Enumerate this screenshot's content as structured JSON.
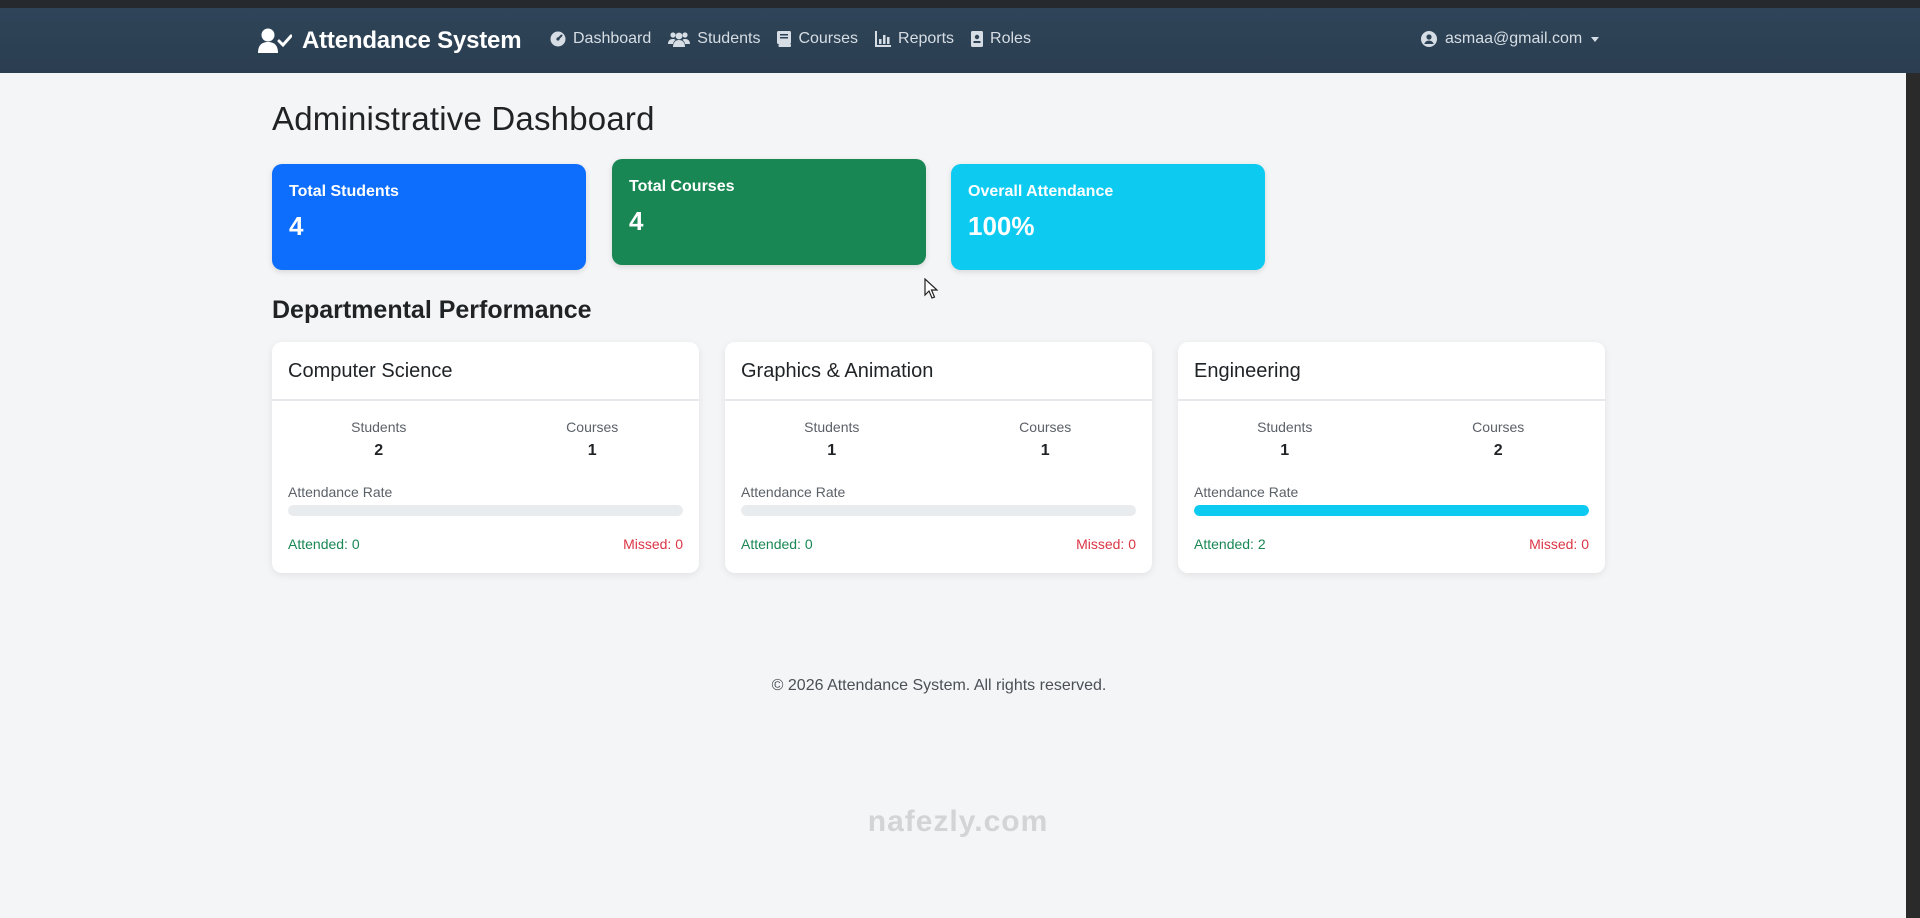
{
  "brand": {
    "title": "Attendance System"
  },
  "nav": [
    {
      "label": "Dashboard",
      "icon": "dashboard-icon"
    },
    {
      "label": "Students",
      "icon": "users-icon"
    },
    {
      "label": "Courses",
      "icon": "book-icon"
    },
    {
      "label": "Reports",
      "icon": "chart-icon"
    },
    {
      "label": "Roles",
      "icon": "id-badge-icon"
    }
  ],
  "user": {
    "email": "asmaa@gmail.com",
    "icon": "user-circle-icon"
  },
  "page": {
    "title": "Administrative Dashboard"
  },
  "stats": [
    {
      "label": "Total Students",
      "value": "4",
      "color": "#0d6efd"
    },
    {
      "label": "Total Courses",
      "value": "4",
      "color": "#198754"
    },
    {
      "label": "Overall Attendance",
      "value": "100%",
      "color": "#0dcaf0"
    }
  ],
  "departments_title": "Departmental Performance",
  "departments": [
    {
      "name": "Computer Science",
      "students_label": "Students",
      "students": "2",
      "courses_label": "Courses",
      "courses": "1",
      "rate_label": "Attendance Rate",
      "rate": 0,
      "attended": "Attended: 0",
      "missed": "Missed: 0"
    },
    {
      "name": "Graphics & Animation",
      "students_label": "Students",
      "students": "1",
      "courses_label": "Courses",
      "courses": "1",
      "rate_label": "Attendance Rate",
      "rate": 0,
      "attended": "Attended: 0",
      "missed": "Missed: 0"
    },
    {
      "name": "Engineering",
      "students_label": "Students",
      "students": "1",
      "courses_label": "Courses",
      "courses": "2",
      "rate_label": "Attendance Rate",
      "rate": 100,
      "attended": "Attended: 2",
      "missed": "Missed: 0"
    }
  ],
  "footer": "© 2026 Attendance System. All rights reserved.",
  "watermark": "nafezly.com"
}
